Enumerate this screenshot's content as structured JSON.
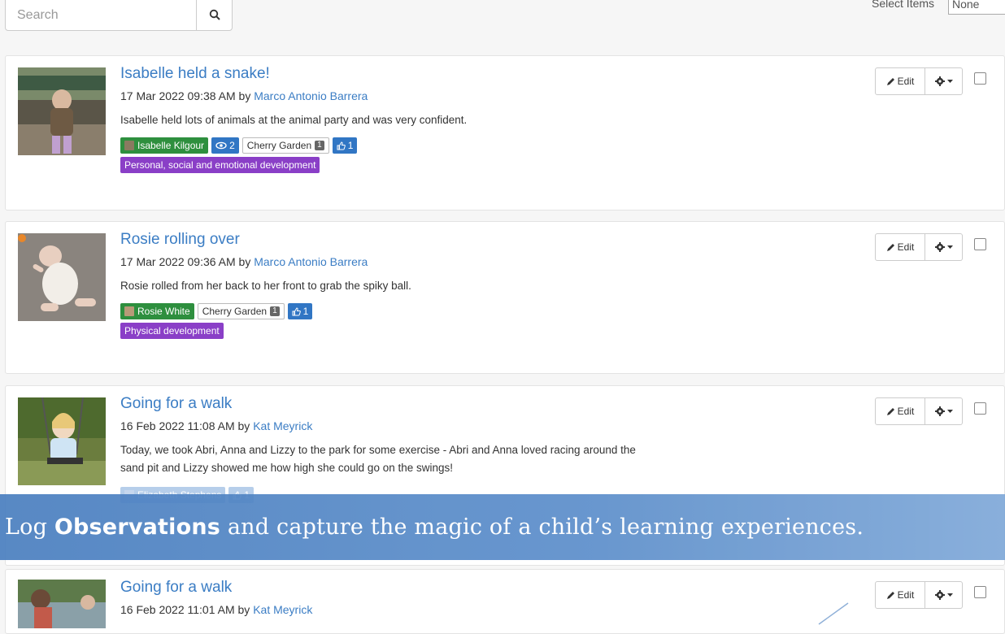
{
  "search": {
    "placeholder": "Search"
  },
  "sort": {
    "label": "Select Items",
    "value": "None"
  },
  "observations": [
    {
      "title": "Isabelle held a snake!",
      "date": "17 Mar 2022 09:38 AM",
      "by": "by",
      "author": "Marco Antonio Barrera",
      "description": "Isabelle held lots of animals at the animal party and was very confident.",
      "child": "Isabelle Kilgour",
      "views": "2",
      "room": "Cherry Garden",
      "room_count": "1",
      "likes": "1",
      "area": "Personal, social and emotional development"
    },
    {
      "title": "Rosie rolling over",
      "date": "17 Mar 2022 09:36 AM",
      "by": "by",
      "author": "Marco Antonio Barrera",
      "description": "Rosie rolled from her back to her front to grab the spiky ball.",
      "child": "Rosie White",
      "room": "Cherry Garden",
      "room_count": "1",
      "likes": "1",
      "area": "Physical development"
    },
    {
      "title": "Going for a walk",
      "date": "16 Feb 2022 11:08 AM",
      "by": "by",
      "author": "Kat Meyrick",
      "description_line1": "Today, we took Abri, Anna and Lizzy to the park for some exercise - Abri and Anna loved racing around the",
      "description_line2": "sand pit and Lizzy showed me how high she could go on the swings!",
      "child": "Elizabeth Stephens",
      "likes": "1"
    },
    {
      "title": "Going for a walk",
      "date": "16 Feb 2022 11:01 AM",
      "by": "by",
      "author": "Kat Meyrick"
    }
  ],
  "actions": {
    "edit_label": "Edit"
  },
  "banner": {
    "prefix": "Log ",
    "bold": "Observations",
    "suffix": " and capture the magic of a child’s learning experiences."
  },
  "icons": {
    "search": "search-icon",
    "edit": "pencil-icon",
    "gear": "gear-icon",
    "views": "eye-icon",
    "likes": "thumbs-up-icon"
  },
  "colors": {
    "link": "#3b7dc4",
    "child_tag": "#2e8f3e",
    "count_tag": "#3176c4",
    "area_tag": "#8a3fc7",
    "banner": "#4a7fc0"
  }
}
